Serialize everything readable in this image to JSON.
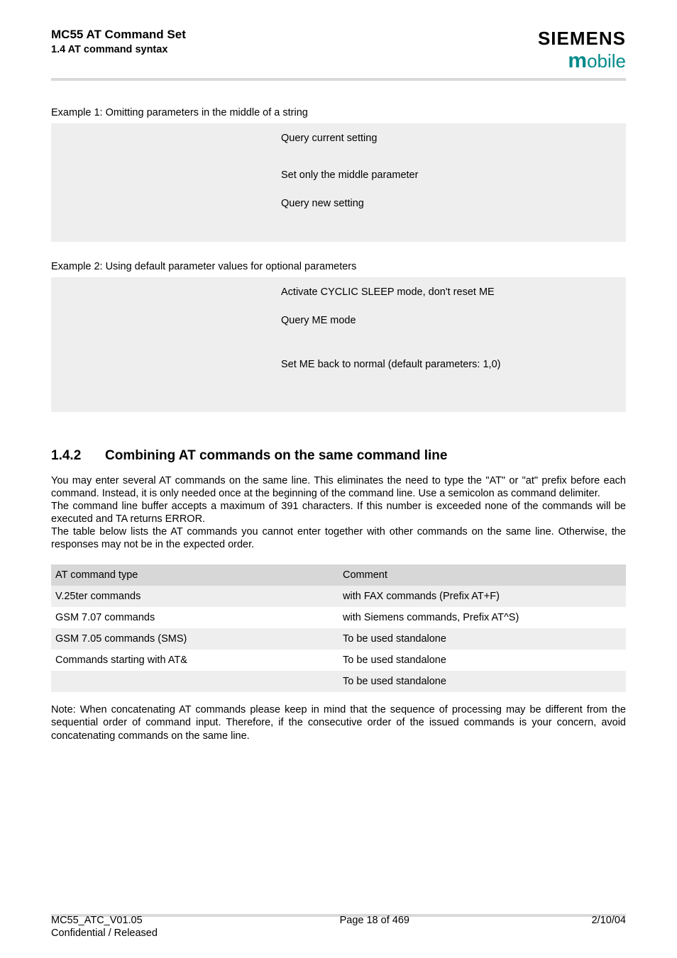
{
  "header": {
    "title": "MC55 AT Command Set",
    "subtitle": "1.4 AT command syntax",
    "brand_top": "SIEMENS",
    "brand_bottom_m": "m",
    "brand_bottom_rest": "obile"
  },
  "example1": {
    "label": "Example 1: Omitting parameters in the middle of a string",
    "rows": [
      {
        "right": "Query current setting"
      },
      {
        "right": "Set only the middle parameter"
      },
      {
        "right": "Query new setting"
      }
    ]
  },
  "example2": {
    "label": "Example 2: Using default parameter values for optional parameters",
    "rows": [
      {
        "right": "Activate CYCLIC SLEEP mode, don't reset ME"
      },
      {
        "right": "Query ME mode"
      },
      {
        "right": "Set ME back to normal (default parameters: 1,0)"
      }
    ]
  },
  "section": {
    "number": "1.4.2",
    "title": "Combining AT commands on the same command line",
    "para1": "You may enter several AT commands on the same line. This eliminates the need to type the \"AT\" or \"at\" prefix before each command. Instead, it is only needed once at the beginning of the command line. Use a semicolon as command delimiter.",
    "para2": "The command line buffer accepts a maximum of 391 characters. If this number is exceeded none of the commands will be executed and TA returns ERROR.",
    "para3": "The table below lists the AT commands you cannot enter together with other commands on the same line. Otherwise, the responses may not be in the expected order."
  },
  "table": {
    "header": {
      "c1": "AT command type",
      "c2": "Comment"
    },
    "rows": [
      {
        "c1": "V.25ter commands",
        "c2": "with FAX commands (Prefix AT+F)"
      },
      {
        "c1": "GSM 7.07 commands",
        "c2": "with Siemens commands, Prefix AT^S)"
      },
      {
        "c1": "GSM 7.05 commands (SMS)",
        "c2": "To be used standalone"
      },
      {
        "c1": "Commands starting with AT&",
        "c2": "To be used standalone"
      },
      {
        "c1": "",
        "c2": "To be used standalone"
      }
    ]
  },
  "note": "Note: When concatenating AT commands please keep in mind that the sequence of processing may be different from the sequential order of command input. Therefore, if the consecutive order of the issued commands is your concern, avoid concatenating commands on the same line.",
  "footer": {
    "left1": "MC55_ATC_V01.05",
    "left2": "Confidential / Released",
    "center": "Page 18 of 469",
    "right": "2/10/04"
  }
}
